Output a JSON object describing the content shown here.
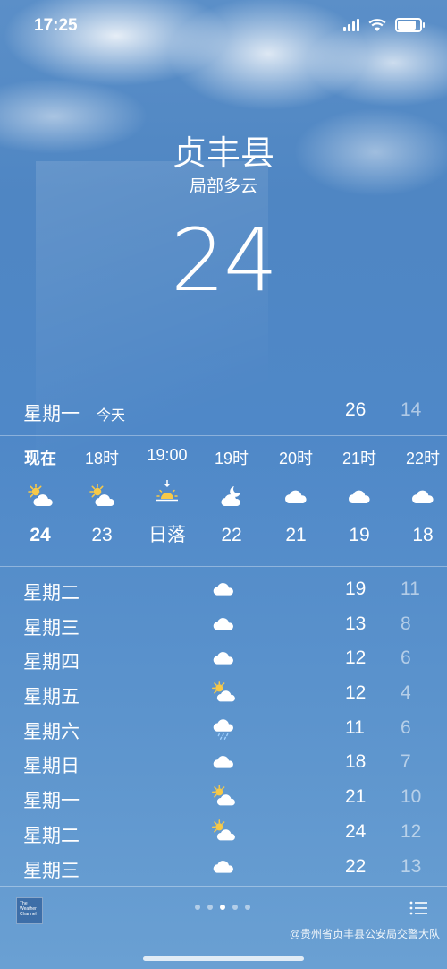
{
  "status_bar": {
    "time": "17:25",
    "battery_level": 0.9
  },
  "header": {
    "location": "贞丰县",
    "condition": "局部多云",
    "temperature": "24"
  },
  "today": {
    "day": "星期一",
    "label": "今天",
    "high": "26",
    "low": "14"
  },
  "hourly": [
    {
      "label": "现在",
      "icon": "partly-cloudy-icon",
      "temp": "24",
      "now": true
    },
    {
      "label": "18时",
      "icon": "partly-cloudy-icon",
      "temp": "23"
    },
    {
      "label": "19:00",
      "icon": "sunset-icon",
      "temp": "日落"
    },
    {
      "label": "19时",
      "icon": "partly-cloudy-night-icon",
      "temp": "22"
    },
    {
      "label": "20时",
      "icon": "cloud-icon",
      "temp": "21"
    },
    {
      "label": "21时",
      "icon": "cloud-icon",
      "temp": "19"
    },
    {
      "label": "22时",
      "icon": "cloud-icon",
      "temp": "18"
    }
  ],
  "daily": [
    {
      "day": "星期二",
      "icon": "cloud-icon",
      "high": "19",
      "low": "11"
    },
    {
      "day": "星期三",
      "icon": "cloud-icon",
      "high": "13",
      "low": "8"
    },
    {
      "day": "星期四",
      "icon": "cloud-icon",
      "high": "12",
      "low": "6"
    },
    {
      "day": "星期五",
      "icon": "partly-cloudy-icon",
      "high": "12",
      "low": "4"
    },
    {
      "day": "星期六",
      "icon": "drizzle-icon",
      "high": "11",
      "low": "6"
    },
    {
      "day": "星期日",
      "icon": "cloud-icon",
      "high": "18",
      "low": "7"
    },
    {
      "day": "星期一",
      "icon": "partly-cloudy-icon",
      "high": "21",
      "low": "10"
    },
    {
      "day": "星期二",
      "icon": "partly-cloudy-icon",
      "high": "24",
      "low": "12"
    },
    {
      "day": "星期三",
      "icon": "cloud-icon",
      "high": "22",
      "low": "13"
    }
  ],
  "footer": {
    "logo_text": "The Weather Channel",
    "page_count": 5,
    "active_page": 3,
    "watermark": "@贵州省贞丰县公安局交警大队"
  }
}
